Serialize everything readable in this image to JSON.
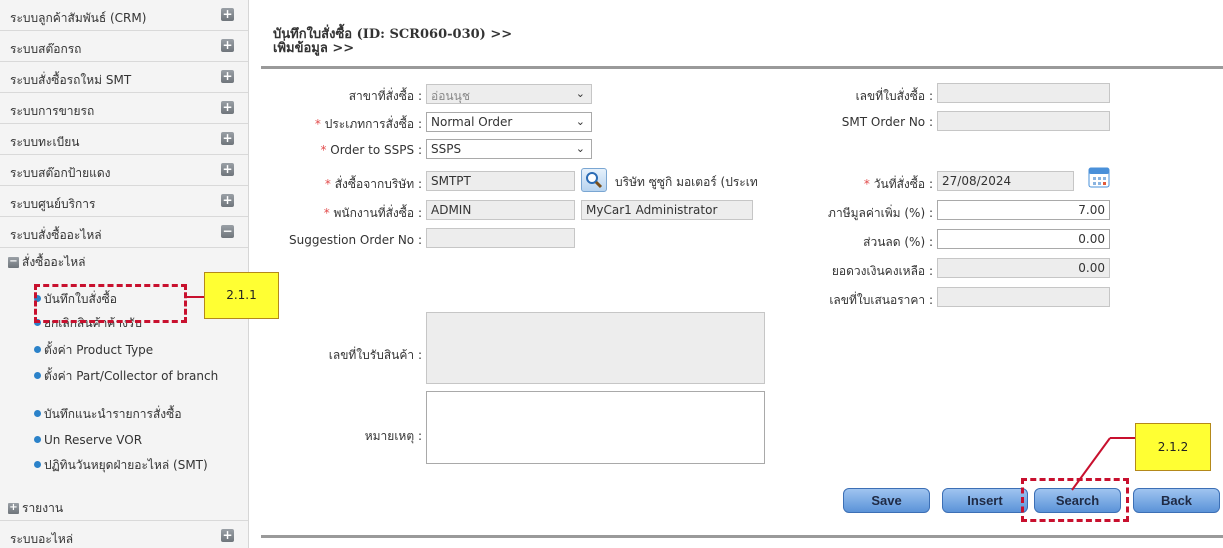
{
  "sidebar": {
    "menus": [
      {
        "label": "ระบบลูกค้าสัมพันธ์ (CRM)",
        "icon": "plus-icon"
      },
      {
        "label": "ระบบสต๊อกรถ",
        "icon": "plus-icon"
      },
      {
        "label": "ระบบสั่งซื้อรถใหม่ SMT",
        "icon": "plus-icon"
      },
      {
        "label": "ระบบการขายรถ",
        "icon": "plus-icon"
      },
      {
        "label": "ระบบทะเบียน",
        "icon": "plus-icon"
      },
      {
        "label": "ระบบสต๊อกป้ายแดง",
        "icon": "plus-icon"
      },
      {
        "label": "ระบบศูนย์บริการ",
        "icon": "plus-icon"
      },
      {
        "label": "ระบบสั่งซื้ออะไหล่",
        "icon": "minus-icon"
      }
    ],
    "submenu_header": "สั่งซื้ออะไหล่",
    "submenu_items": [
      "บันทึกใบสั่งซื้อ",
      "ยกเลิกสินค้าค้างรับ",
      "ตั้งค่า Product Type",
      "ตั้งค่า Part/Collector of branch",
      "บันทึกแนะนำรายการสั่งซื้อ",
      "Un Reserve VOR",
      "ปฏิทินวันหยุดฝ่ายอะไหล่ (SMT)"
    ],
    "report_label": "รายงาน",
    "bottom_menu": {
      "label": "ระบบอะไหล่",
      "icon": "plus-icon"
    }
  },
  "header": {
    "title_line1": "บันทึกใบสั่งซื้อ (ID: SCR060-030) >>",
    "title_line2": "เพิ่มข้อมูล >>"
  },
  "form": {
    "branch_label": "สาขาที่สั่งซื้อ :",
    "branch_value": "อ่อนนุช",
    "order_type_label": "ประเภทการสั่งซื้อ :",
    "order_type_value": "Normal Order",
    "order_sps_label": "Order to SSPS :",
    "order_sps_value": "SSPS",
    "company_label": "สั่งซื้อจากบริษัท :",
    "company_code": "SMTPT",
    "company_name": "บริษัท ซูซูกิ มอเตอร์ (ประเท",
    "staff_label": "พนักงานที่สั่งซื้อ :",
    "staff_code": "ADMIN",
    "staff_name": "MyCar1 Administrator",
    "suggestion_label": "Suggestion Order No :",
    "suggestion_value": "",
    "po_no_label": "เลขที่ใบสั่งซื้อ :",
    "po_no_value": "",
    "smt_order_label": "SMT Order No :",
    "smt_order_value": "",
    "order_date_label": "วันที่สั่งซื้อ :",
    "order_date_value": "27/08/2024",
    "vat_label": "ภาษีมูลค่าเพิ่ม (%) :",
    "vat_value": "7.00",
    "discount_label": "ส่วนลด (%) :",
    "discount_value": "0.00",
    "credit_label": "ยอดวงเงินคงเหลือ :",
    "credit_value": "0.00",
    "quotation_label": "เลขที่ใบเสนอราคา :",
    "quotation_value": "",
    "receipt_label": "เลขที่ใบรับสินค้า :",
    "receipt_value": "",
    "remark_label": "หมายเหตุ :",
    "remark_value": ""
  },
  "buttons": {
    "save": "Save",
    "insert": "Insert",
    "search": "Search",
    "back": "Back"
  },
  "annotations": {
    "step1": "2.1.1",
    "step2": "2.1.2"
  },
  "colors": {
    "required": "#e24b4b",
    "button": "#6fa3e0",
    "highlight": "#c8102e",
    "callout": "#ffff33"
  }
}
